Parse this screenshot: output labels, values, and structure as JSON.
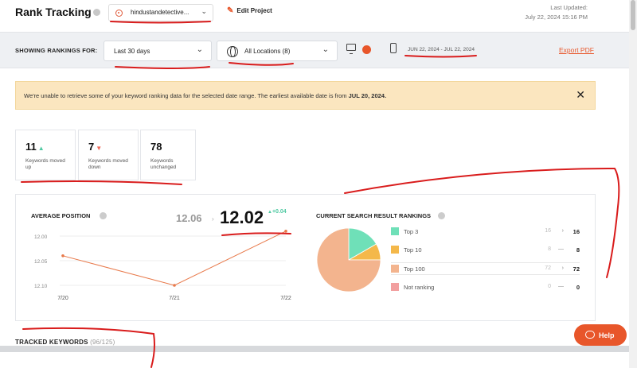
{
  "header": {
    "title": "Rank Tracking",
    "project_name": "hindustandetective...",
    "edit_label": "Edit Project",
    "updated_label": "Last Updated:",
    "updated_value": "July 22, 2024 15:16 PM"
  },
  "filters": {
    "showing_label": "SHOWING RANKINGS FOR:",
    "date_selected": "Last 30 days",
    "location_selected": "All Locations (8)",
    "date_range": "JUN 22, 2024 - JUL 22, 2024",
    "export_label": "Export PDF"
  },
  "alert": {
    "message": "We're unable to retrieve some of your keyword ranking data for the selected date range. The earliest available date is from ",
    "date": "JUL 20, 2024."
  },
  "stats": [
    {
      "value": "11",
      "direction": "up",
      "label": "Keywords moved up"
    },
    {
      "value": "7",
      "direction": "down",
      "label": "Keywords moved down"
    },
    {
      "value": "78",
      "direction": "none",
      "label": "Keywords unchanged"
    }
  ],
  "average_position": {
    "title": "AVERAGE POSITION",
    "previous": "12.06",
    "current": "12.02",
    "delta": "+0.04"
  },
  "chart_data": {
    "type": "line",
    "x": [
      "7/20",
      "7/21",
      "7/22"
    ],
    "series": [
      {
        "values": [
          12.04,
          12.1,
          11.99
        ]
      }
    ],
    "y_ticks": [
      "12.00",
      "12.05",
      "12.10"
    ],
    "ylim": [
      12.1,
      11.99
    ],
    "y_inverted": true,
    "colors": {
      "line": "#e8794a"
    }
  },
  "results": {
    "title": "CURRENT SEARCH RESULT RANKINGS",
    "rows": [
      {
        "name": "Top 3",
        "previous": "16",
        "current": "16",
        "color": "#6fe0b8"
      },
      {
        "name": "Top 10",
        "previous": "8",
        "current": "8",
        "color": "#f4b84a"
      },
      {
        "name": "Top 100",
        "previous": "72",
        "current": "72",
        "color": "#f3b48e"
      },
      {
        "name": "Not ranking",
        "previous": "0",
        "current": "0",
        "color": "#f2a0a0"
      }
    ]
  },
  "tracked": {
    "label": "TRACKED KEYWORDS",
    "count": "(96/125)"
  },
  "help_button": {
    "label": "Help"
  },
  "colors": {
    "accent": "#e8562a",
    "up": "#4fc9a2",
    "down": "#ef6a5a",
    "alert_bg": "#fbe6bf"
  }
}
